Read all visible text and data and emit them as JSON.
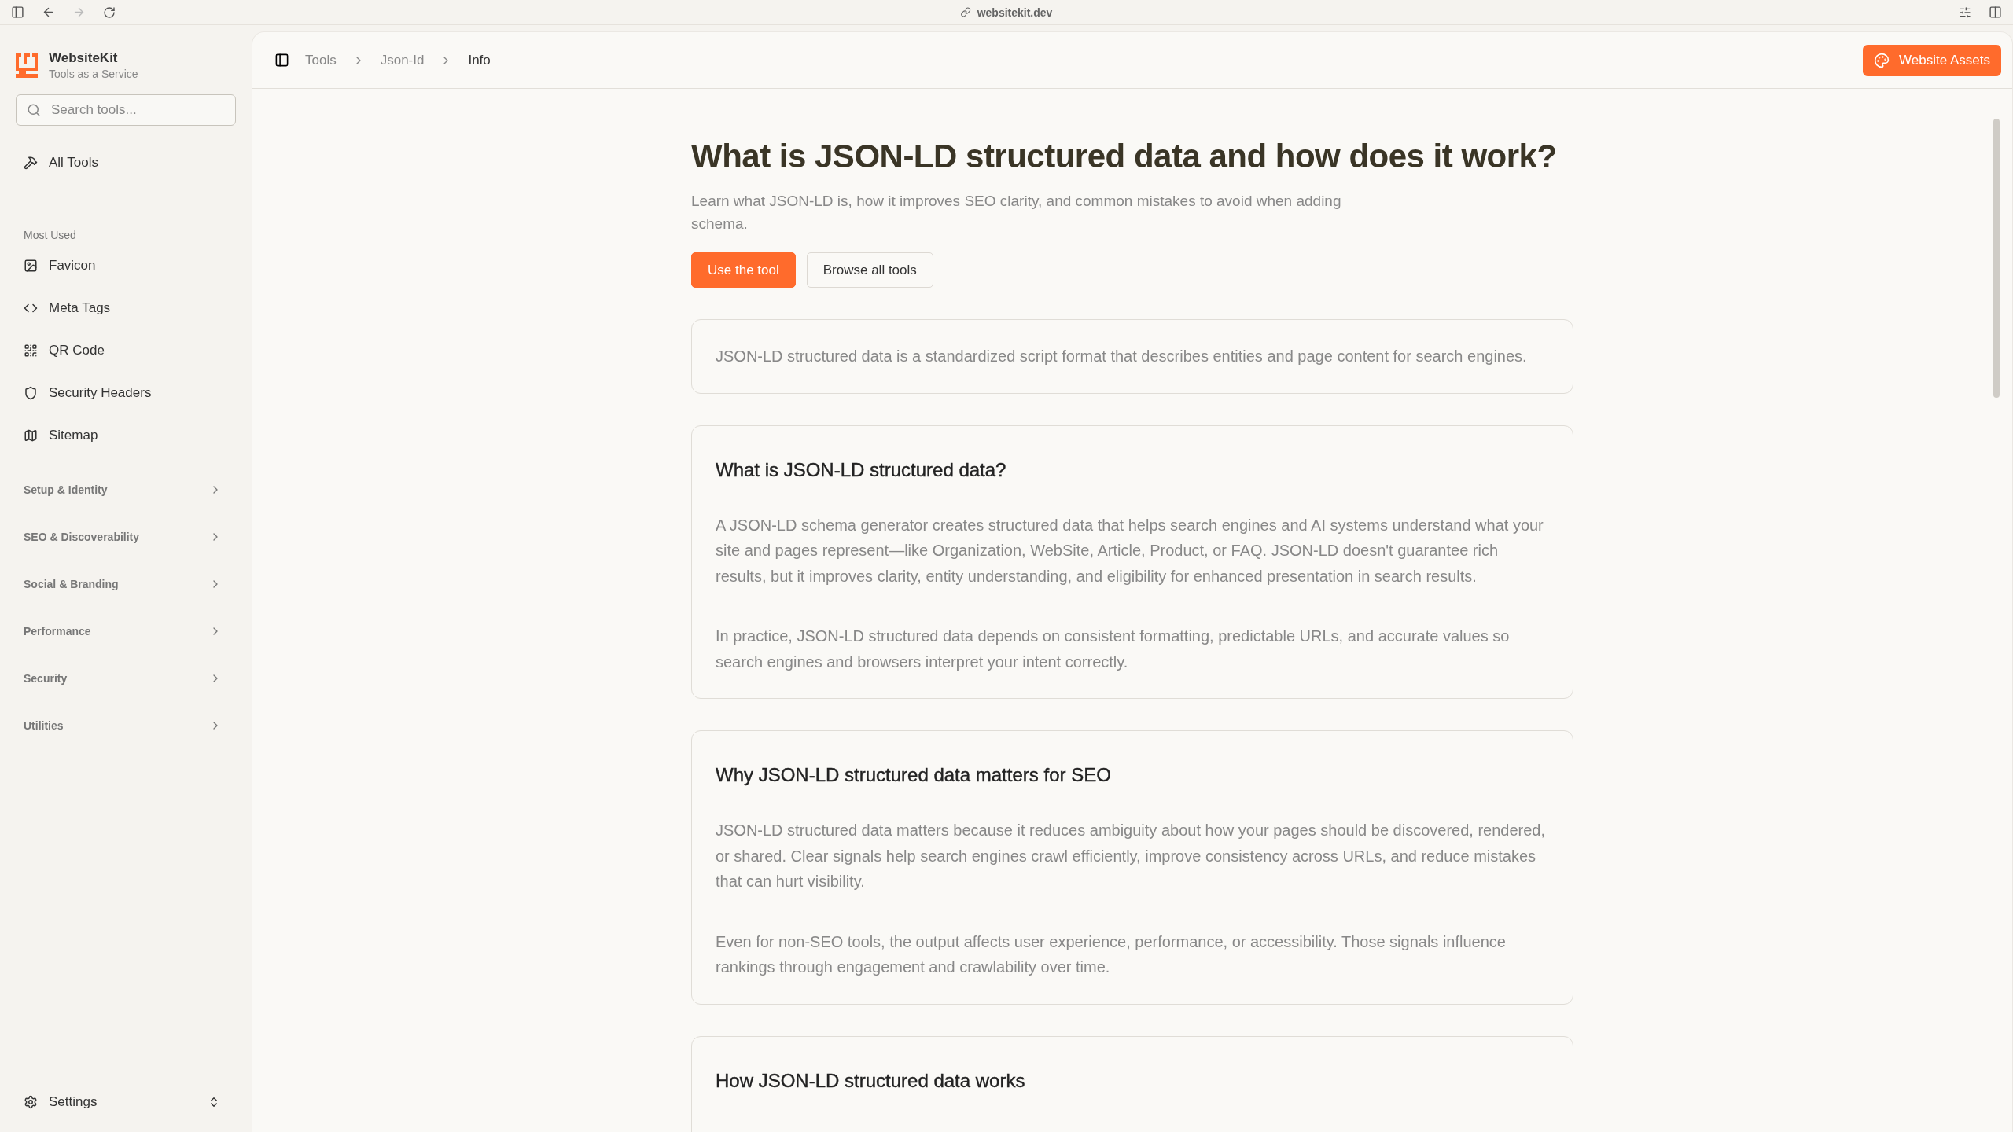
{
  "browser": {
    "url": "websitekit.dev"
  },
  "sidebar": {
    "brand": {
      "name": "WebsiteKit",
      "tagline": "Tools as a Service"
    },
    "search": {
      "placeholder": "Search tools..."
    },
    "all_tools": "All Tools",
    "section_label": "Most Used",
    "most_used": [
      "Favicon",
      "Meta Tags",
      "QR Code",
      "Security Headers",
      "Sitemap"
    ],
    "groups": [
      {
        "label": "Setup & Identity",
        "expanded": false
      },
      {
        "label": "SEO & Discoverability",
        "expanded": false
      },
      {
        "label": "Social & Branding",
        "expanded": false
      },
      {
        "label": "Performance",
        "expanded": false
      },
      {
        "label": "Security",
        "expanded": false
      },
      {
        "label": "Utilities",
        "expanded": false
      }
    ],
    "settings": "Settings"
  },
  "header": {
    "breadcrumbs": [
      "Tools",
      "Json-Id",
      "Info"
    ],
    "button": "Website Assets"
  },
  "article": {
    "title": "What is JSON-LD structured data and how does it work?",
    "lead": "Learn what JSON-LD is, how it improves SEO clarity, and common mistakes to avoid when adding schema.",
    "buttons": [
      {
        "label": "Use the tool",
        "kind": "primary"
      },
      {
        "label": "Browse all tools",
        "kind": "secondary"
      }
    ],
    "summary": "JSON-LD structured data is a standardized script format that describes entities and page content for search engines.",
    "sections": [
      {
        "heading": "What is JSON-LD structured data?",
        "paragraphs": [
          "A JSON-LD schema generator creates structured data that helps search engines and AI systems understand what your site and pages represent—like Organization, WebSite, Article, Product, or FAQ. JSON-LD doesn't guarantee rich results, but it improves clarity, entity understanding, and eligibility for enhanced presentation in search results.",
          "In practice, JSON-LD structured data depends on consistent formatting, predictable URLs, and accurate values so search engines and browsers interpret your intent correctly."
        ]
      },
      {
        "heading": "Why JSON-LD structured data matters for SEO",
        "paragraphs": [
          "JSON-LD structured data matters because it reduces ambiguity about how your pages should be discovered, rendered, or shared. Clear signals help search engines crawl efficiently, improve consistency across URLs, and reduce mistakes that can hurt visibility.",
          "Even for non-SEO tools, the output affects user experience, performance, or accessibility. Those signals influence rankings through engagement and crawlability over time."
        ]
      },
      {
        "heading": "How JSON-LD structured data works"
      }
    ]
  }
}
